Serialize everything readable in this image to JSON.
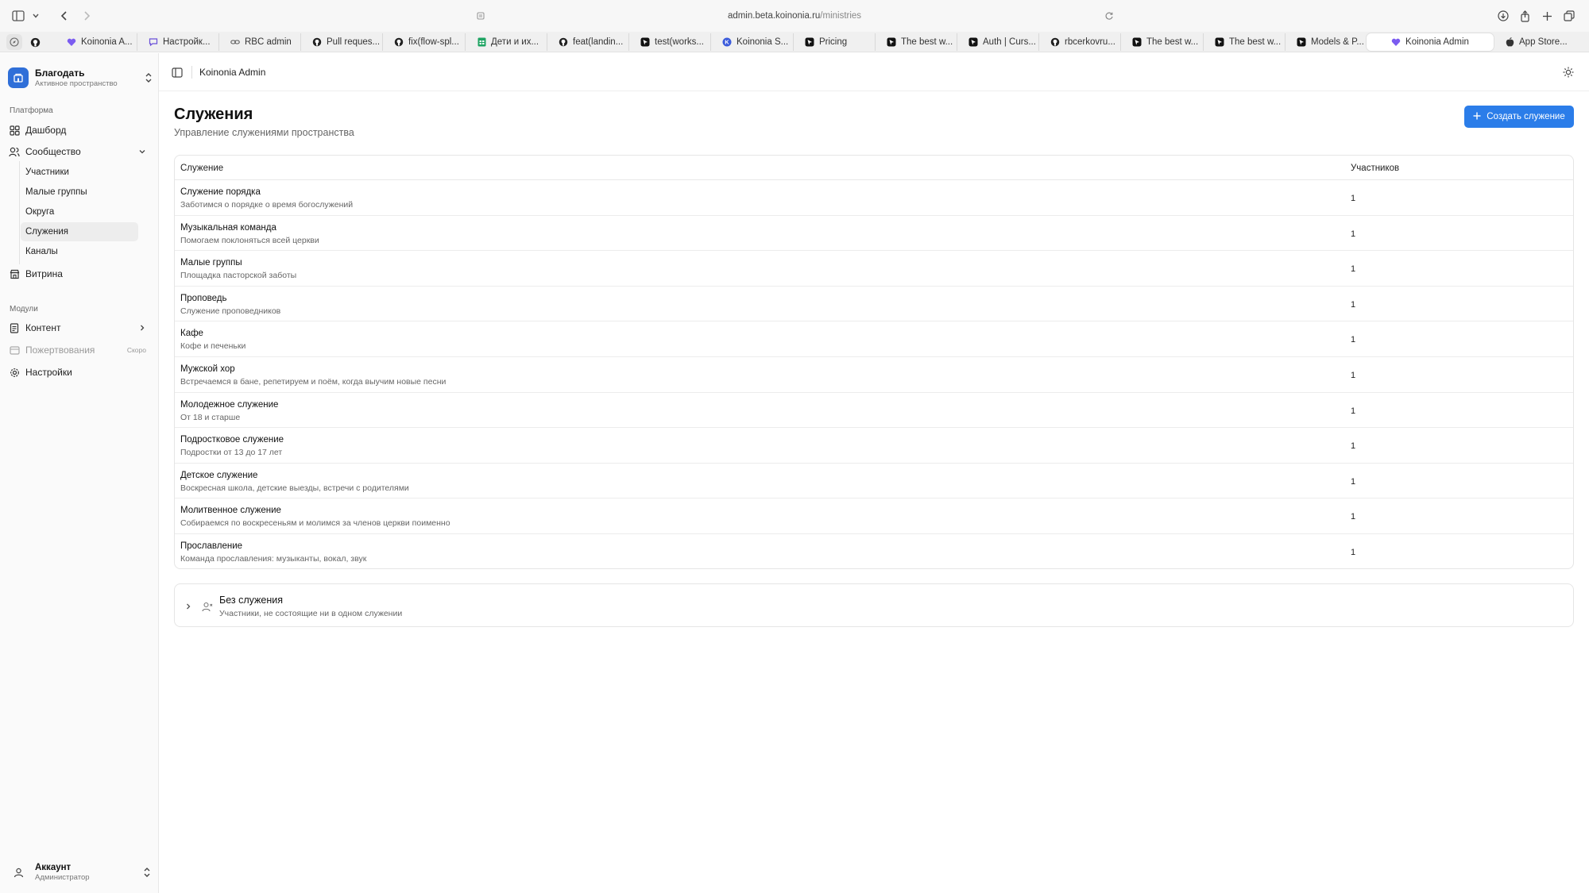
{
  "browser": {
    "url_host": "admin.beta.koinonia.ru",
    "url_path": "/ministries",
    "tabs": [
      {
        "label": "Koinonia A...",
        "icon": "heart-icon"
      },
      {
        "label": "Настройк...",
        "icon": "chat-icon"
      },
      {
        "label": "RBC admin",
        "icon": "link-icon"
      },
      {
        "label": "Pull reques...",
        "icon": "github-icon"
      },
      {
        "label": "fix(flow-spl...",
        "icon": "github-icon"
      },
      {
        "label": "Дети и их...",
        "icon": "sheets-icon"
      },
      {
        "label": "feat(landin...",
        "icon": "github-icon"
      },
      {
        "label": "test(works...",
        "icon": "cursor-icon"
      },
      {
        "label": "Koinonia S...",
        "icon": "k-icon"
      },
      {
        "label": "Pricing",
        "icon": "cursor-icon"
      },
      {
        "label": "The best w...",
        "icon": "cursor-icon"
      },
      {
        "label": "Auth | Curs...",
        "icon": "cursor-icon"
      },
      {
        "label": "rbcerkovru...",
        "icon": "github-icon"
      },
      {
        "label": "The best w...",
        "icon": "cursor-icon"
      },
      {
        "label": "The best w...",
        "icon": "cursor-icon"
      },
      {
        "label": "Models & P...",
        "icon": "cursor-icon"
      },
      {
        "label": "Koinonia Admin",
        "icon": "heart-icon",
        "active": true
      },
      {
        "label": "App Store...",
        "icon": "apple-icon"
      }
    ]
  },
  "workspace": {
    "name": "Благодать",
    "subtitle": "Активное пространство"
  },
  "sidebar": {
    "platform_label": "Платформа",
    "dashboard": "Дашборд",
    "community": "Сообщество",
    "community_items": [
      "Участники",
      "Малые группы",
      "Округа",
      "Служения",
      "Каналы"
    ],
    "showcase": "Витрина",
    "modules_label": "Модули",
    "content": "Контент",
    "donations": "Пожертвования",
    "donations_badge": "Скоро",
    "settings": "Настройки"
  },
  "account": {
    "name": "Аккаунт",
    "role": "Администратор"
  },
  "header": {
    "title": "Koinonia Admin"
  },
  "page": {
    "title": "Служения",
    "subtitle": "Управление служениями пространства",
    "create_button": "Создать служение"
  },
  "table": {
    "columns": [
      "Служение",
      "Участников"
    ],
    "rows": [
      {
        "name": "Служение порядка",
        "desc": "Заботимся о порядке о время богослужений",
        "count": "1"
      },
      {
        "name": "Музыкальная команда",
        "desc": "Помогаем поклоняться всей церкви",
        "count": "1"
      },
      {
        "name": "Малые группы",
        "desc": "Площадка пасторской заботы",
        "count": "1"
      },
      {
        "name": "Проповедь",
        "desc": "Служение проповедников",
        "count": "1"
      },
      {
        "name": "Кафе",
        "desc": "Кофе и печеньки",
        "count": "1"
      },
      {
        "name": "Мужской хор",
        "desc": "Встречаемся в бане, репетируем и поём, когда выучим новые песни",
        "count": "1"
      },
      {
        "name": "Молодежное служение",
        "desc": "От 18 и старше",
        "count": "1"
      },
      {
        "name": "Подростковое служение",
        "desc": "Подростки от 13 до 17 лет",
        "count": "1"
      },
      {
        "name": "Детское служение",
        "desc": "Воскресная школа, детские выезды, встречи с родителями",
        "count": "1"
      },
      {
        "name": "Молитвенное служение",
        "desc": "Собираемся по воскресеньям и молимся за членов церкви поименно",
        "count": "1"
      },
      {
        "name": "Прославление",
        "desc": "Команда прославления: музыканты, вокал, звук",
        "count": "1"
      }
    ]
  },
  "unassigned": {
    "title": "Без служения",
    "subtitle": "Участники, не состоящие ни в одном служении"
  },
  "colors": {
    "accent": "#2b7de9",
    "workspace_logo": "#2f6fd8"
  }
}
